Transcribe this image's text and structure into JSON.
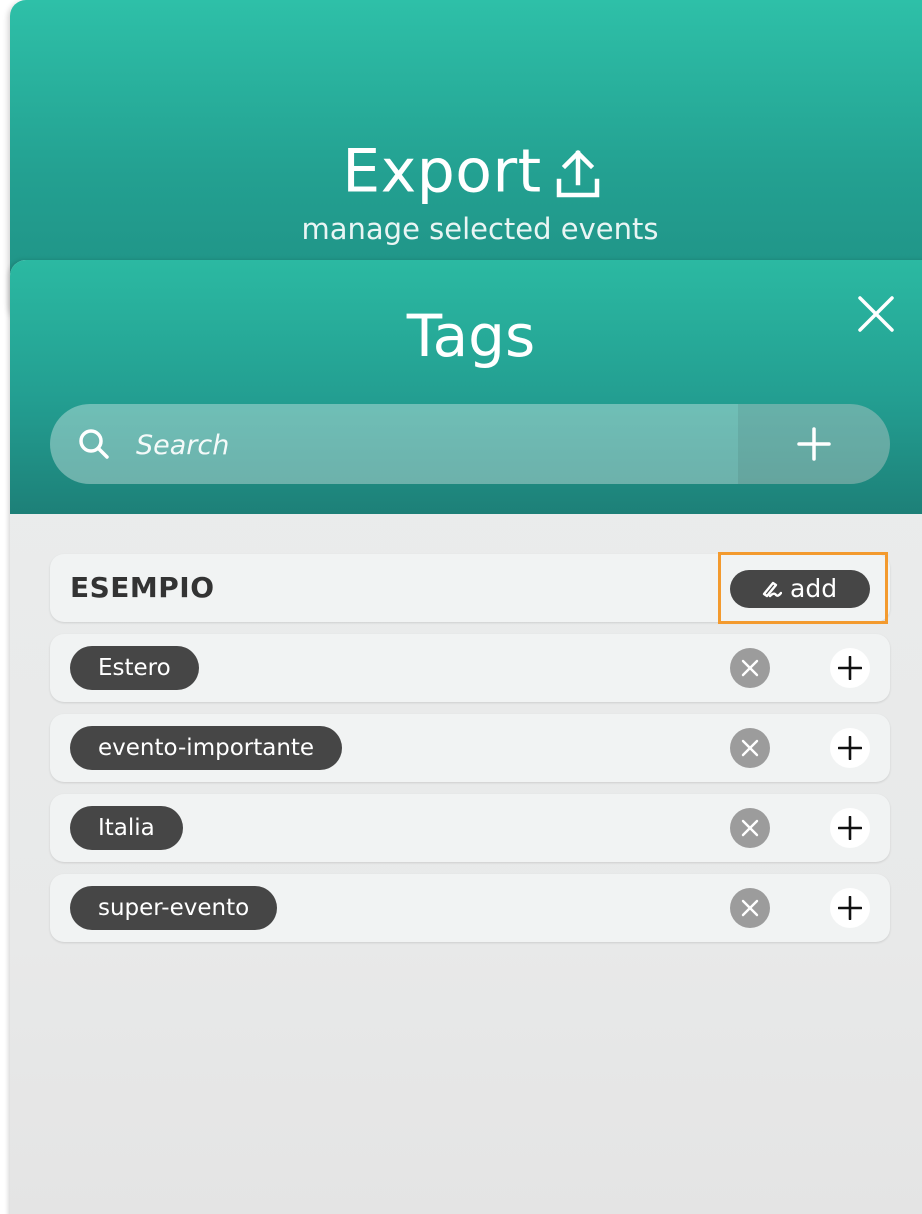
{
  "export_panel": {
    "title": "Export",
    "subtitle": "manage selected events",
    "icon": "upload-icon"
  },
  "tags_panel": {
    "title": "Tags",
    "close_icon": "close-icon",
    "search": {
      "placeholder": "Search",
      "value": "",
      "search_icon": "search-icon",
      "add_icon": "plus-icon"
    },
    "group": {
      "name": "ESEMPIO",
      "add_label": "add",
      "add_icon": "pen-icon",
      "highlight_color": "#f39a2e"
    },
    "tags": [
      {
        "label": "Estero"
      },
      {
        "label": "evento-importante"
      },
      {
        "label": "Italia"
      },
      {
        "label": "super-evento"
      }
    ]
  },
  "colors": {
    "accent_top": "#2ec0a8",
    "accent_bottom": "#1d8078",
    "chip": "#464646",
    "remove": "#9c9c9c",
    "highlight": "#f39a2e"
  }
}
